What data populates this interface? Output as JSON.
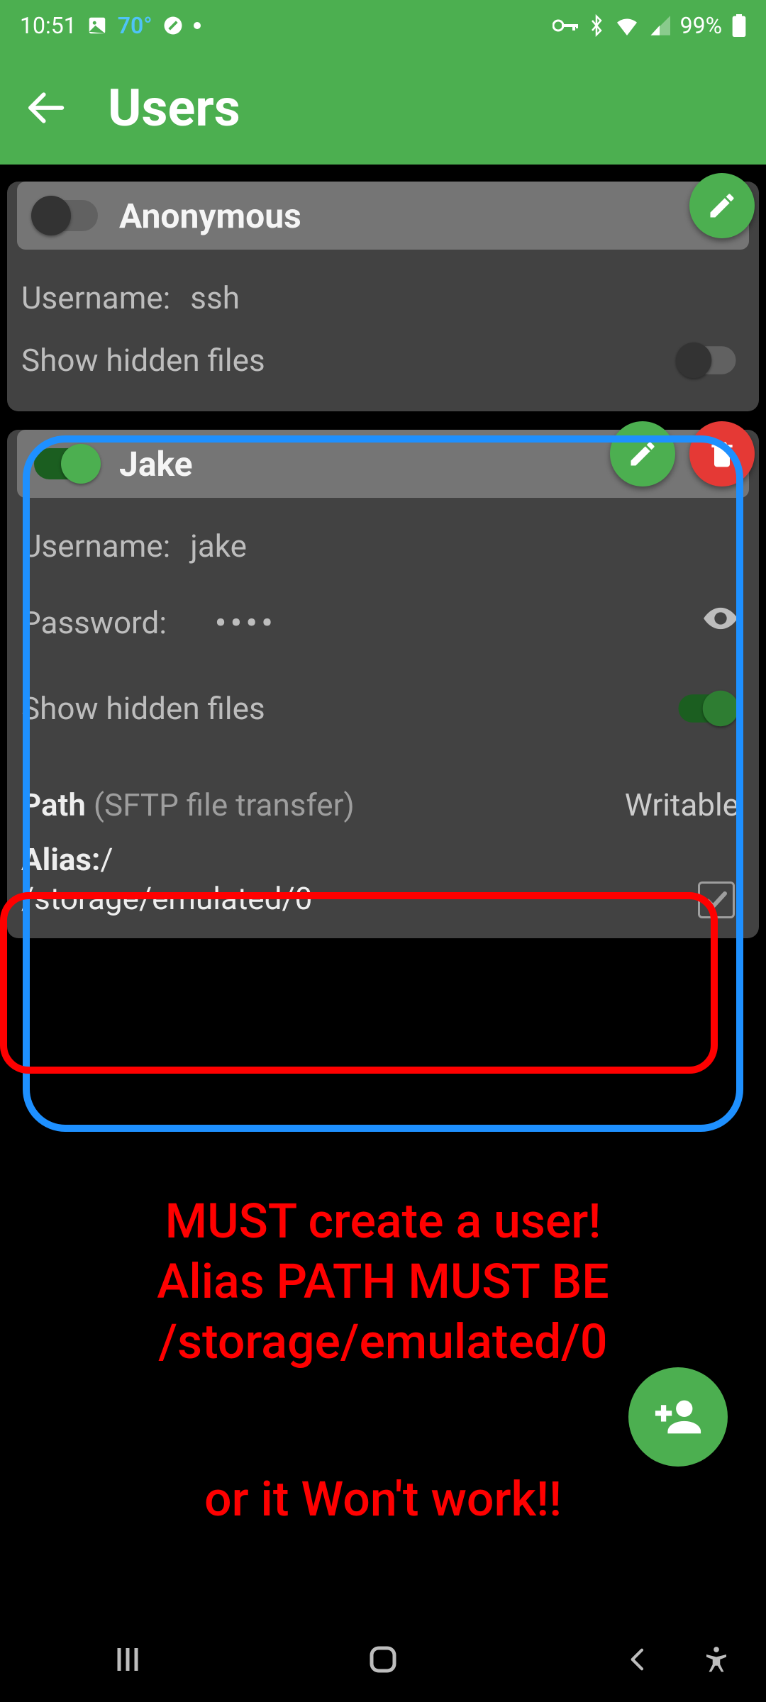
{
  "status_bar": {
    "time": "10:51",
    "temp": "70°",
    "battery_pct": "99%"
  },
  "app_bar": {
    "title": "Users"
  },
  "users": [
    {
      "display_name": "Anonymous",
      "enabled": false,
      "username_label": "Username:",
      "username_value": "ssh",
      "hidden_label": "Show hidden files",
      "hidden_on": false,
      "has_delete": false
    },
    {
      "display_name": "Jake",
      "enabled": true,
      "username_label": "Username:",
      "username_value": "jake",
      "password_label": "Password:",
      "password_masked": "••••",
      "hidden_label": "Show hidden files",
      "hidden_on": true,
      "path_section_label": "Path (SFTP file transfer)",
      "writable_label": "Writable",
      "alias_label": "Alias:",
      "alias_value": "/",
      "alias_path": "/storage/emulated/0",
      "writable_checked": true,
      "has_delete": true
    }
  ],
  "annotation": {
    "line1": "MUST create a user!",
    "line2": "Alias PATH MUST BE",
    "line3": "/storage/emulated/0",
    "line4": "or it Won't work!!"
  }
}
